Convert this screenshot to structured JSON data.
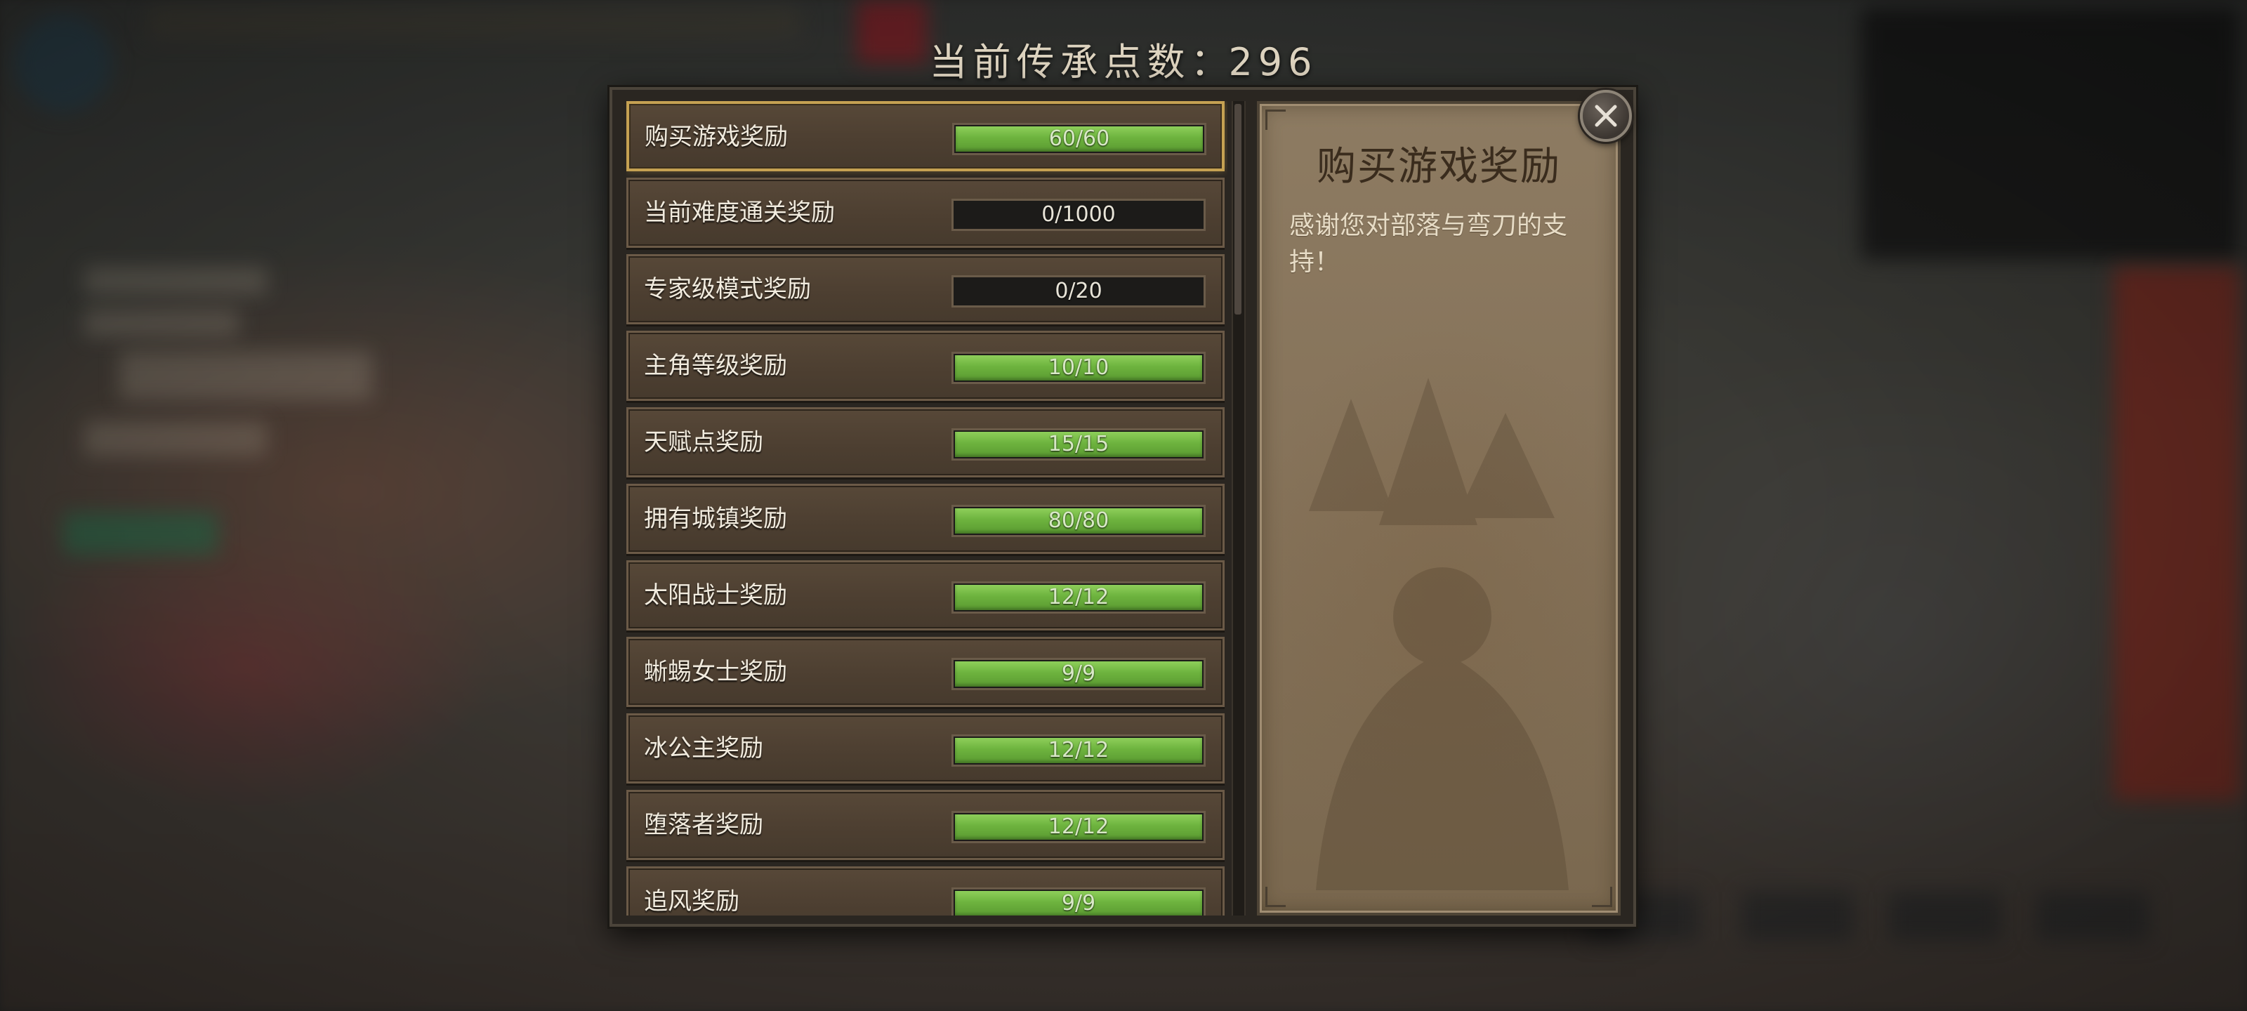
{
  "header": {
    "points_label": "当前传承点数",
    "points_separator": "：",
    "points_value": "296"
  },
  "rewards": [
    {
      "label": "购买游戏奖励",
      "progress": "60/60",
      "current": 60,
      "max": 60,
      "selected": true
    },
    {
      "label": "当前难度通关奖励",
      "progress": "0/1000",
      "current": 0,
      "max": 1000,
      "selected": false
    },
    {
      "label": "专家级模式奖励",
      "progress": "0/20",
      "current": 0,
      "max": 20,
      "selected": false
    },
    {
      "label": "主角等级奖励",
      "progress": "10/10",
      "current": 10,
      "max": 10,
      "selected": false
    },
    {
      "label": "天赋点奖励",
      "progress": "15/15",
      "current": 15,
      "max": 15,
      "selected": false
    },
    {
      "label": "拥有城镇奖励",
      "progress": "80/80",
      "current": 80,
      "max": 80,
      "selected": false
    },
    {
      "label": "太阳战士奖励",
      "progress": "12/12",
      "current": 12,
      "max": 12,
      "selected": false
    },
    {
      "label": "蜥蜴女士奖励",
      "progress": "9/9",
      "current": 9,
      "max": 9,
      "selected": false
    },
    {
      "label": "冰公主奖励",
      "progress": "12/12",
      "current": 12,
      "max": 12,
      "selected": false
    },
    {
      "label": "堕落者奖励",
      "progress": "12/12",
      "current": 12,
      "max": 12,
      "selected": false
    },
    {
      "label": "追风奖励",
      "progress": "9/9",
      "current": 9,
      "max": 9,
      "selected": false
    }
  ],
  "detail": {
    "title": "购买游戏奖励",
    "description": "感谢您对部落与弯刀的支持！"
  },
  "colors": {
    "bar_fill": "#6db33e",
    "selected_border": "#c5a152",
    "row_bg": "#4d3f31",
    "detail_bg": "#857259"
  },
  "icons": {
    "close": "close-icon"
  }
}
